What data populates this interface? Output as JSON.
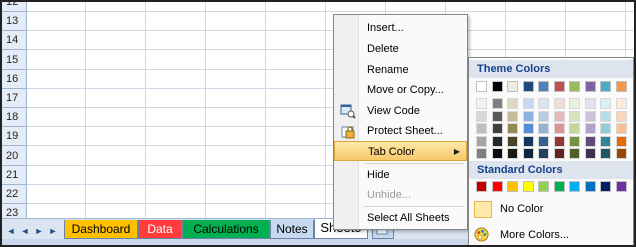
{
  "rows": [
    "12",
    "13",
    "14",
    "15",
    "16",
    "17",
    "18",
    "19",
    "20",
    "21",
    "22",
    "23"
  ],
  "sheet_tabs": [
    {
      "label": "Dashboard",
      "color": "#ffc000"
    },
    {
      "label": "Data",
      "color": "#ff3b3b"
    },
    {
      "label": "Calculations",
      "color": "#00b050"
    },
    {
      "label": "Notes",
      "color": "#c6d9f0"
    },
    {
      "label": "Sheet5",
      "color": "#ffffff",
      "active": true
    }
  ],
  "nav_buttons": [
    "◄",
    "◄",
    "►",
    "►"
  ],
  "context_menu": {
    "items": [
      {
        "label": "Insert...",
        "icon": null
      },
      {
        "label": "Delete",
        "icon": null
      },
      {
        "label": "Rename",
        "icon": null
      },
      {
        "label": "Move or Copy...",
        "icon": null
      },
      {
        "label": "View Code",
        "icon": "view-code-icon"
      },
      {
        "label": "Protect Sheet...",
        "icon": "protect-sheet-icon"
      },
      {
        "label": "Tab Color",
        "icon": null,
        "highlighted": true,
        "submenu": true
      },
      {
        "label": "Hide",
        "icon": null
      },
      {
        "label": "Unhide...",
        "icon": null,
        "disabled": true
      },
      {
        "label": "Select All Sheets",
        "icon": null
      }
    ]
  },
  "color_menu": {
    "theme_heading": "Theme Colors",
    "standard_heading": "Standard Colors",
    "no_color_label": "No Color",
    "more_colors_label": "More Colors...",
    "theme_base": [
      "#ffffff",
      "#000000",
      "#eeece1",
      "#1f497d",
      "#4f81bd",
      "#c0504d",
      "#9bbb59",
      "#8064a2",
      "#4bacc6",
      "#f79646"
    ],
    "theme_shades": [
      [
        "#f2f2f2",
        "#7f7f7f",
        "#ddd9c3",
        "#c6d9f0",
        "#dbe5f1",
        "#f2dcdb",
        "#ebf1dd",
        "#e5e0ec",
        "#dbeef3",
        "#fdeada"
      ],
      [
        "#d8d8d8",
        "#595959",
        "#c4bd97",
        "#8db3e2",
        "#b8cce4",
        "#e5b9b7",
        "#d7e3bc",
        "#ccc1d9",
        "#b7dde8",
        "#fbd5b5"
      ],
      [
        "#bfbfbf",
        "#3f3f3f",
        "#938953",
        "#548dd4",
        "#95b3d7",
        "#d99694",
        "#c3d69b",
        "#b2a2c7",
        "#92cddc",
        "#fac08f"
      ],
      [
        "#a5a5a5",
        "#262626",
        "#494429",
        "#17365d",
        "#366092",
        "#953734",
        "#76923c",
        "#5f497a",
        "#31859b",
        "#e36c09"
      ],
      [
        "#7f7f7f",
        "#0c0c0c",
        "#1d1b10",
        "#0f243e",
        "#244061",
        "#632423",
        "#4f6128",
        "#3f3151",
        "#205867",
        "#974806"
      ]
    ],
    "standard": [
      "#c00000",
      "#ff0000",
      "#ffc000",
      "#ffff00",
      "#92d050",
      "#00b050",
      "#00b0f0",
      "#0070c0",
      "#002060",
      "#7030a0"
    ]
  }
}
